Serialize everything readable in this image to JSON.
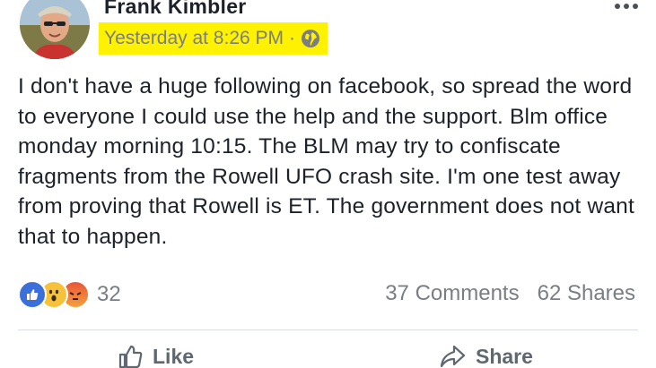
{
  "post": {
    "author": "Frank Kimbler",
    "timestamp": "Yesterday at 8:26 PM",
    "separator": "·",
    "privacy_icon": "globe-icon",
    "highlight_color": "#fff200",
    "body": "I don't have a huge following on facebook, so spread the word to everyone I could use the help and the support. Blm office monday morning 10:15. The BLM may try to confiscate fragments from the Rowell UFO crash site. I'm one test away from proving that Rowell is ET. The government does not want that to happen.",
    "reactions": {
      "types": [
        "like",
        "wow",
        "angry"
      ],
      "count": "32"
    },
    "comments": "37 Comments",
    "shares": "62 Shares",
    "actions": {
      "like": "Like",
      "share": "Share"
    }
  }
}
